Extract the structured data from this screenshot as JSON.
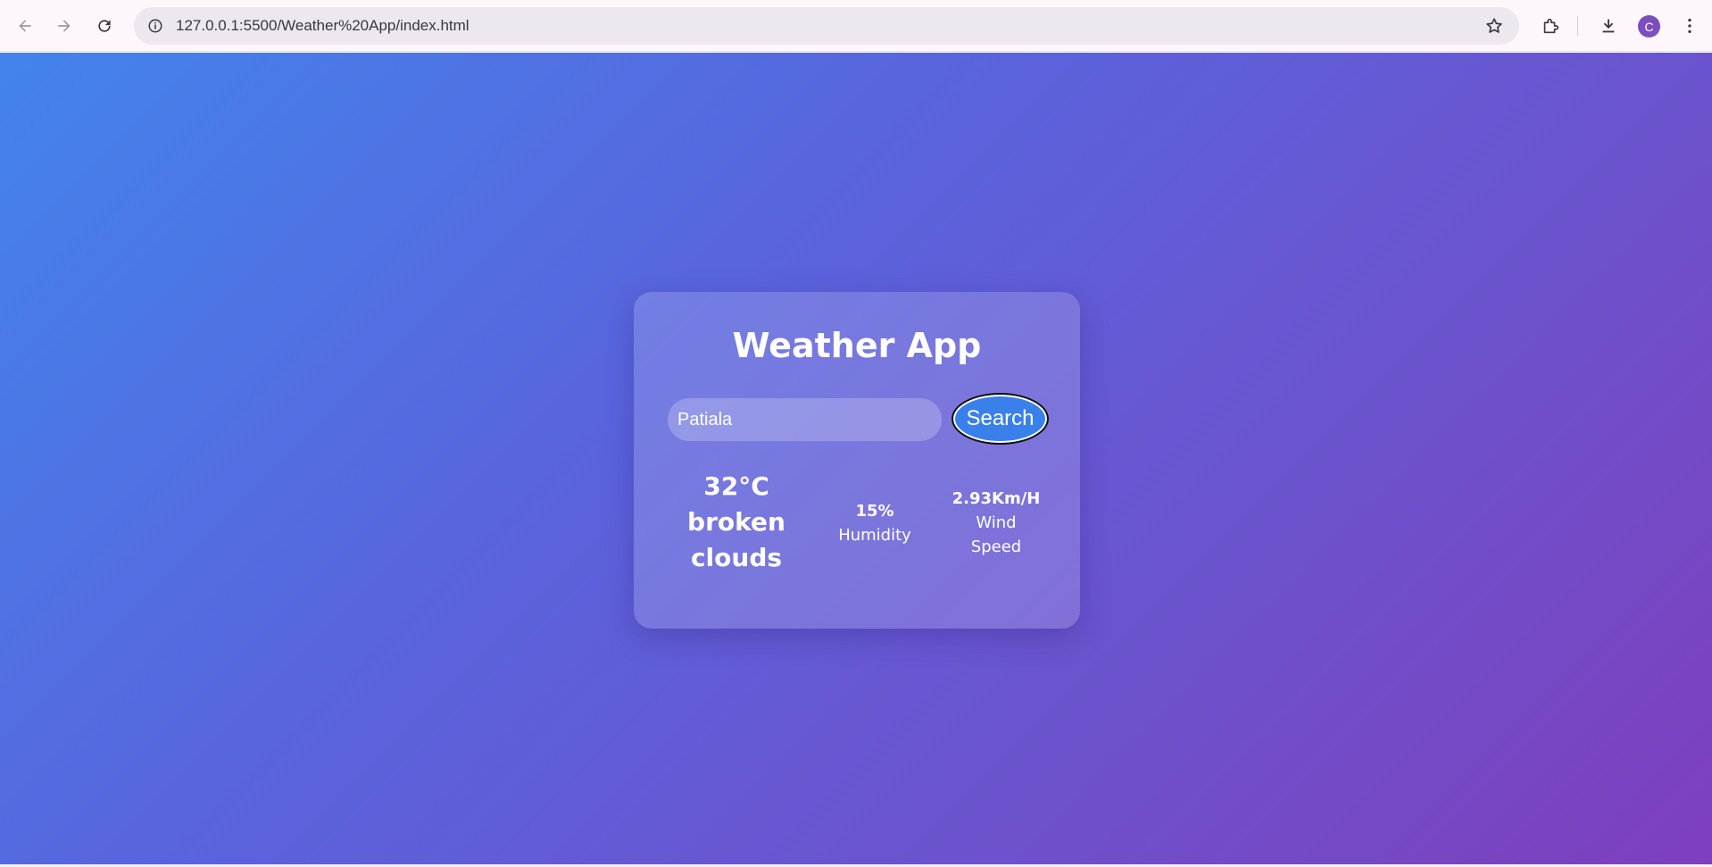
{
  "browser": {
    "url": "127.0.0.1:5500/Weather%20App/index.html",
    "profile_initial": "C",
    "icons": [
      "back-icon",
      "forward-icon",
      "reload-icon",
      "site-info-icon",
      "star-icon",
      "extensions-icon",
      "download-icon",
      "menu-icon"
    ]
  },
  "app": {
    "title": "Weather App",
    "search": {
      "value": "Patiala",
      "placeholder": "",
      "button_label": "Search"
    },
    "temperature": "32°C",
    "description_line1": "broken",
    "description_line2": "clouds",
    "humidity": {
      "value": "15%",
      "label": "Humidity"
    },
    "wind": {
      "value": "2.93Km/H",
      "label_line1": "Wind",
      "label_line2": "Speed"
    }
  },
  "colors": {
    "gradient_start": "#4384ec",
    "gradient_end": "#7e3fbd",
    "button": "#3a80ea",
    "avatar": "#7c4dbd"
  }
}
